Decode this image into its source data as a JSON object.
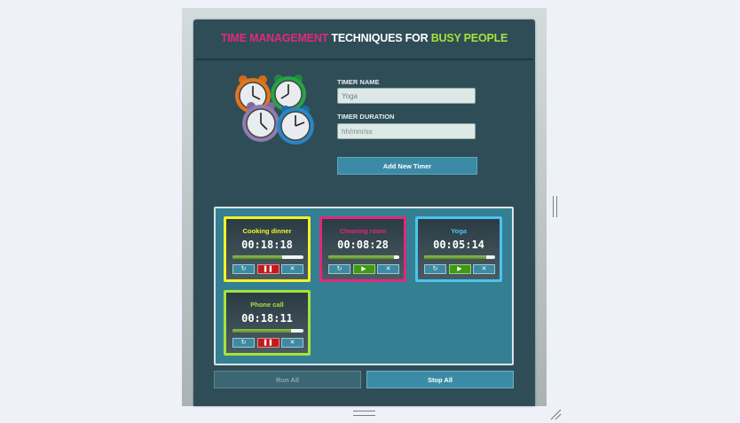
{
  "header": {
    "title_part1": "TIME MANAGEMENT",
    "title_part2": " TECHNIQUES FOR ",
    "title_part3": "BUSY PEOPLE",
    "colors": {
      "part1": "#e0297d",
      "part2": "#ffffff",
      "part3": "#a6e23a"
    }
  },
  "form": {
    "name_label": "TIMER NAME",
    "name_value": "Yoga",
    "duration_label": "TIMER DURATION",
    "duration_placeholder": "hh/mm/ss",
    "add_button": "Add New Timer"
  },
  "timers": [
    {
      "name": "Cooking dinner",
      "time": "00:18:18",
      "color": "#f2f227",
      "progress": 0.7,
      "state": "running",
      "toggle_icon": "pause-icon"
    },
    {
      "name": "Cleaning room",
      "time": "00:08:28",
      "color": "#e0297d",
      "progress": 0.93,
      "state": "paused",
      "toggle_icon": "play-icon"
    },
    {
      "name": "Yoga",
      "time": "00:05:14",
      "color": "#4cc3f0",
      "progress": 0.88,
      "state": "paused",
      "toggle_icon": "play-icon"
    },
    {
      "name": "Phone call",
      "time": "00:18:11",
      "color": "#a6e23a",
      "progress": 0.83,
      "state": "running",
      "toggle_icon": "pause-icon"
    }
  ],
  "controls": {
    "reset_icon": "↻",
    "pause_icon": "❚❚",
    "play_icon": "▶",
    "remove_icon": "✕"
  },
  "footer": {
    "run_all": "Run All",
    "stop_all": "Stop All"
  }
}
